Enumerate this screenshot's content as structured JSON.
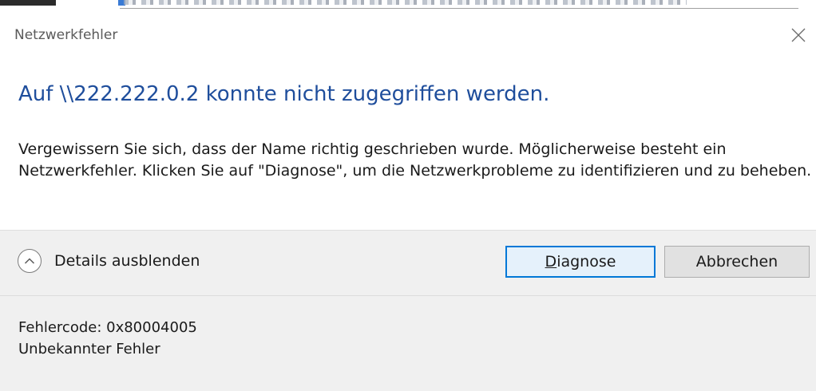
{
  "dialog": {
    "title": "Netzwerkfehler",
    "heading": "Auf \\\\222.222.0.2 konnte nicht zugegriffen werden.",
    "message": "Vergewissern Sie sich, dass der Name richtig geschrieben wurde. Möglicherweise besteht ein Netzwerkfehler. Klicken Sie auf \"Diagnose\", um die Netzwerkprobleme zu identifizieren und zu beheben.",
    "details_toggle_label": "Details ausblenden",
    "buttons": {
      "diagnose": {
        "accel": "D",
        "rest": "iagnose"
      },
      "cancel": "Abbrechen"
    },
    "details": {
      "error_code": "Fehlercode: 0x80004005",
      "error_text": "Unbekannter Fehler"
    }
  },
  "icons": {
    "close": "close-icon",
    "collapse": "chevron-up-icon"
  },
  "colors": {
    "heading": "#1f4e9c",
    "footer_bg": "#f0f0f0",
    "default_button_border": "#0078d7",
    "default_button_bg": "#e5f1fb"
  }
}
